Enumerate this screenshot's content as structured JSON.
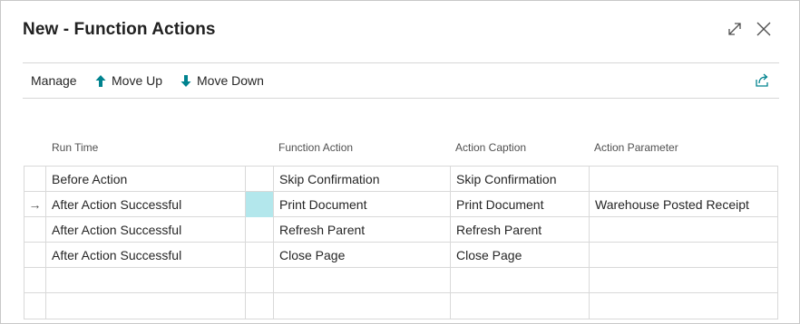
{
  "window": {
    "title": "New - Function Actions",
    "expand_icon": "expand-icon",
    "close_icon": "close-icon"
  },
  "toolbar": {
    "manage_label": "Manage",
    "move_up_label": "Move Up",
    "move_down_label": "Move Down",
    "share_icon": "share-icon",
    "accent_color": "#00838f"
  },
  "table": {
    "columns": [
      "Run Time",
      "Function Action",
      "Action Caption",
      "Action Parameter"
    ],
    "rows": [
      {
        "indicator": "",
        "run_time": "Before Action",
        "function_action": "Skip Confirmation",
        "action_caption": "Skip Confirmation",
        "action_parameter": ""
      },
      {
        "indicator": "→",
        "run_time": "After Action Successful",
        "function_action": "Print Document",
        "action_caption": "Print Document",
        "action_parameter": "Warehouse Posted Receipt"
      },
      {
        "indicator": "",
        "run_time": "After Action Successful",
        "function_action": "Refresh Parent",
        "action_caption": "Refresh Parent",
        "action_parameter": ""
      },
      {
        "indicator": "",
        "run_time": "After Action Successful",
        "function_action": "Close Page",
        "action_caption": "Close Page",
        "action_parameter": ""
      },
      {
        "indicator": "",
        "run_time": "",
        "function_action": "",
        "action_caption": "",
        "action_parameter": ""
      },
      {
        "indicator": "",
        "run_time": "",
        "function_action": "",
        "action_caption": "",
        "action_parameter": ""
      }
    ],
    "selected_row_index": 1,
    "selection_color": "#b3e7ec"
  }
}
